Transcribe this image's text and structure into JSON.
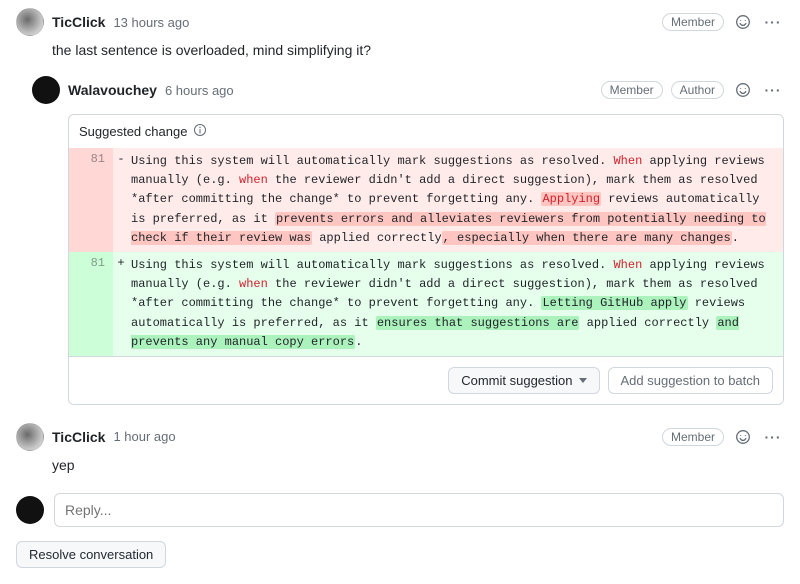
{
  "comments": [
    {
      "author": "TicClick",
      "time": "13 hours ago",
      "roles": [
        "Member"
      ],
      "body": "the last sentence is overloaded, mind simplifying it?"
    },
    {
      "author": "Walavouchey",
      "time": "6 hours ago",
      "roles": [
        "Member",
        "Author"
      ],
      "suggestion": {
        "label": "Suggested change",
        "line_no": "81",
        "removed": {
          "plain": "Using this system will automatically mark suggestions as resolved. ",
          "r1": "When",
          "plain2": " applying reviews manually (e.g. ",
          "r2": "when",
          "plain3": " the reviewer didn't add a direct suggestion), mark them as resolved *after committing the change* to prevent forgetting any. ",
          "h1": "Applying",
          "plain4": " reviews automatically is preferred, as it ",
          "h2": "prevents errors and alleviates reviewers from potentially needing to check if their review was",
          "plain5": " applied correctly",
          "h3": ", especially when there are many changes",
          "plain6": "."
        },
        "added": {
          "plain": "Using this system will automatically mark suggestions as resolved. ",
          "r1": "When",
          "plain2": " applying reviews manually (e.g. ",
          "r2": "when",
          "plain3": " the reviewer didn't add a direct suggestion), mark them as resolved *after committing the change* to prevent forgetting any. ",
          "h1": "Letting GitHub apply",
          "plain4": " reviews automatically is preferred, as it ",
          "h2": "ensures that suggestions are",
          "plain5": " applied correctly ",
          "h3": "and prevents any manual copy errors",
          "plain6": "."
        },
        "commit_btn": "Commit suggestion",
        "batch_btn": "Add suggestion to batch"
      }
    },
    {
      "author": "TicClick",
      "time": "1 hour ago",
      "roles": [
        "Member"
      ],
      "body": "yep"
    }
  ],
  "reply_placeholder": "Reply...",
  "resolve_label": "Resolve conversation"
}
